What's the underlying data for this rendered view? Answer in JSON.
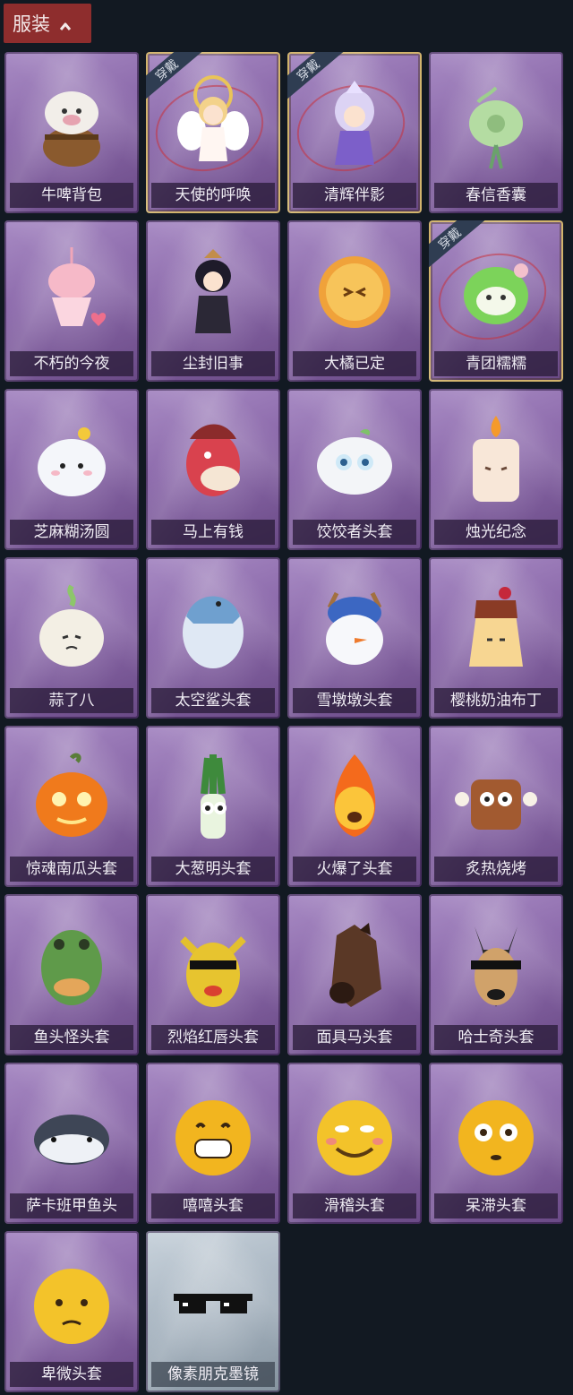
{
  "header": {
    "title": "服装"
  },
  "worn_text": "穿戴",
  "items": [
    {
      "label": "牛啤背包",
      "icon": "cow-beer-barrel-icon",
      "worn": false
    },
    {
      "label": "天使的呼唤",
      "icon": "angel-figure-icon",
      "worn": true
    },
    {
      "label": "清辉伴影",
      "icon": "silver-hair-figure-icon",
      "worn": true
    },
    {
      "label": "春信香囊",
      "icon": "green-sachet-icon",
      "worn": false
    },
    {
      "label": "不朽的今夜",
      "icon": "pink-fox-sundae-icon",
      "worn": false
    },
    {
      "label": "尘封旧事",
      "icon": "dark-prince-figure-icon",
      "worn": false
    },
    {
      "label": "大橘已定",
      "icon": "orange-slice-icon",
      "worn": false
    },
    {
      "label": "青团糯糯",
      "icon": "green-rice-ball-icon",
      "worn": true
    },
    {
      "label": "芝麻糊汤圆",
      "icon": "white-dumpling-icon",
      "worn": false
    },
    {
      "label": "马上有钱",
      "icon": "red-horse-head-icon",
      "worn": false
    },
    {
      "label": "饺饺者头套",
      "icon": "dumpling-head-icon",
      "worn": false
    },
    {
      "label": "烛光纪念",
      "icon": "candle-head-icon",
      "worn": false
    },
    {
      "label": "蒜了八",
      "icon": "garlic-head-icon",
      "worn": false
    },
    {
      "label": "太空鲨头套",
      "icon": "shark-helmet-icon",
      "worn": false
    },
    {
      "label": "雪墩墩头套",
      "icon": "snowman-head-icon",
      "worn": false
    },
    {
      "label": "樱桃奶油布丁",
      "icon": "pudding-head-icon",
      "worn": false
    },
    {
      "label": "惊魂南瓜头套",
      "icon": "pumpkin-head-icon",
      "worn": false
    },
    {
      "label": "大葱明头套",
      "icon": "scallion-head-icon",
      "worn": false
    },
    {
      "label": "火爆了头套",
      "icon": "fireball-head-icon",
      "worn": false
    },
    {
      "label": "炙热烧烤",
      "icon": "bbq-meat-head-icon",
      "worn": false
    },
    {
      "label": "鱼头怪头套",
      "icon": "fish-mask-icon",
      "worn": false
    },
    {
      "label": "烈焰红唇头套",
      "icon": "yellow-mouse-mask-icon",
      "worn": false
    },
    {
      "label": "面具马头套",
      "icon": "horse-mask-icon",
      "worn": false
    },
    {
      "label": "哈士奇头套",
      "icon": "husky-mask-icon",
      "worn": false
    },
    {
      "label": "萨卡班甲鱼头",
      "icon": "armored-fish-head-icon",
      "worn": false
    },
    {
      "label": "嘻嘻头套",
      "icon": "grinning-emoji-head-icon",
      "worn": false
    },
    {
      "label": "滑稽头套",
      "icon": "smirk-emoji-head-icon",
      "worn": false
    },
    {
      "label": "呆滞头套",
      "icon": "stunned-emoji-head-icon",
      "worn": false
    },
    {
      "label": "卑微头套",
      "icon": "pleading-emoji-head-icon",
      "worn": false
    },
    {
      "label": "像素朋克墨镜",
      "icon": "pixel-sunglasses-icon",
      "worn": false,
      "rarity": "common"
    }
  ],
  "colors": {
    "background": "#121922",
    "header": "#8e2d2d",
    "card_purple": "#8c6aab",
    "card_gray": "#a7b4c0",
    "worn_border": "#d2b46c"
  }
}
